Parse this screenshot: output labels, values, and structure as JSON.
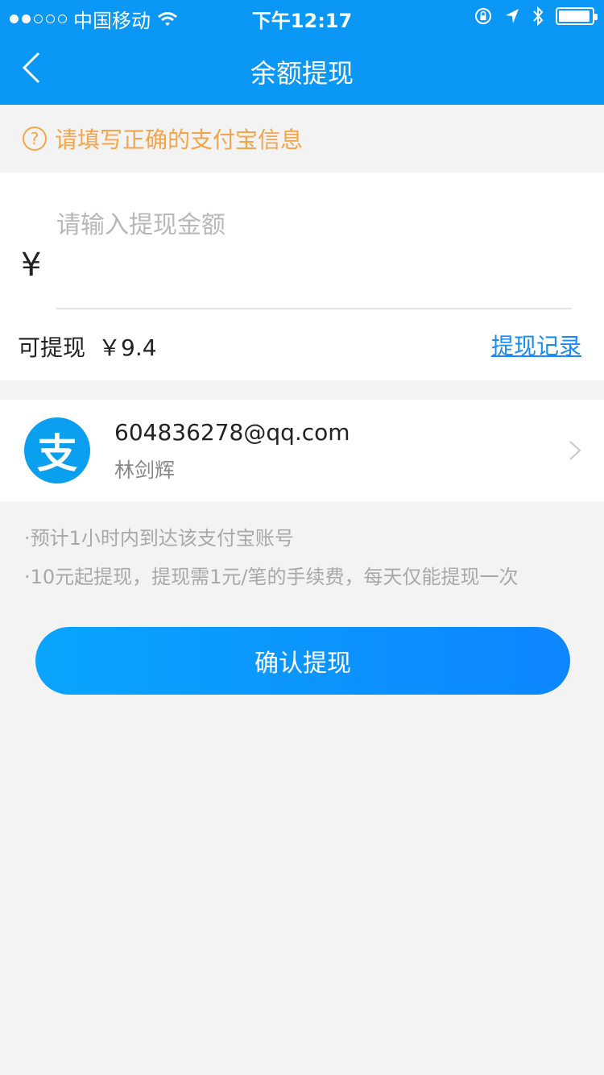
{
  "status_bar": {
    "carrier": "中国移动",
    "time": "下午12:17"
  },
  "nav": {
    "title": "余额提现"
  },
  "notice": {
    "text": "请填写正确的支付宝信息"
  },
  "amount": {
    "currency_symbol": "¥",
    "placeholder": "请输入提现金额",
    "available_label": "可提现",
    "available_value": "￥9.4",
    "records_link": "提现记录"
  },
  "account": {
    "logo_char": "支",
    "email": "604836278@qq.com",
    "name": "林剑辉"
  },
  "tips": [
    "·预计1小时内到达该支付宝账号",
    "·10元起提现，提现需1元/笔的手续费，每天仅能提现一次"
  ],
  "confirm_button": "确认提现",
  "colors": {
    "primary": "#0a97f5",
    "notice": "#f4a54a",
    "link": "#1a8bf0",
    "background": "#f3f3f3"
  },
  "icons": [
    "wifi-icon",
    "lock-rotation-icon",
    "location-icon",
    "bluetooth-icon",
    "battery-icon",
    "back-arrow-icon",
    "question-icon",
    "alipay-logo",
    "chevron-right-icon"
  ]
}
